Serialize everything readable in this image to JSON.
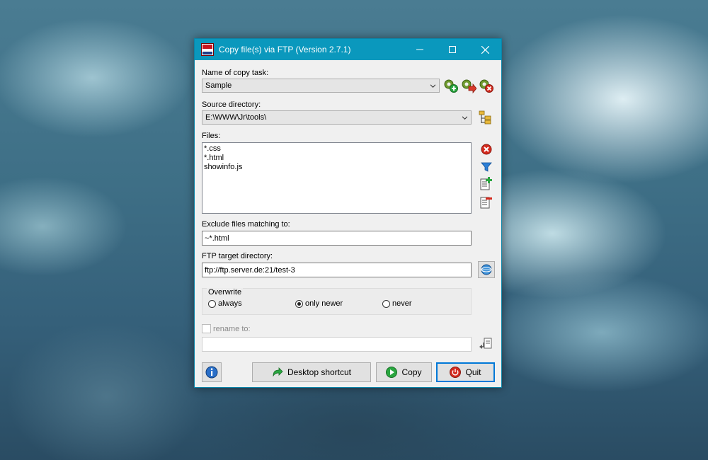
{
  "window": {
    "title": "Copy file(s) via FTP (Version 2.7.1)",
    "controls": [
      "minimize",
      "maximize",
      "close"
    ]
  },
  "task": {
    "label": "Name of copy task:",
    "value": "Sample"
  },
  "source": {
    "label": "Source directory:",
    "value": "E:\\WWW\\Jr\\tools\\"
  },
  "files": {
    "label": "Files:",
    "items": [
      "*.css",
      "*.html",
      "showinfo.js"
    ]
  },
  "exclude": {
    "label": "Exclude files matching to:",
    "value": "~*.html"
  },
  "target": {
    "label": "FTP target directory:",
    "value": "ftp://ftp.server.de:21/test-3"
  },
  "overwrite": {
    "label": "Overwrite",
    "options": [
      "always",
      "only newer",
      "never"
    ],
    "selected": "only newer"
  },
  "rename": {
    "label": "rename to:",
    "checked": false,
    "value": ""
  },
  "buttons": {
    "desktop_shortcut": "Desktop shortcut",
    "copy": "Copy",
    "quit": "Quit"
  },
  "icons": {
    "add_task": "add-task-icon",
    "copy_task": "copy-task-icon",
    "delete_task": "delete-task-icon",
    "browse_folder": "folder-tree-icon",
    "clear_files": "clear-icon",
    "filter": "filter-icon",
    "add_file": "add-file-icon",
    "remove_file": "remove-file-icon",
    "ftp_browse": "ftp-browse-icon",
    "rename_apply": "rename-apply-icon",
    "info": "info-icon"
  },
  "colors": {
    "titlebar": "#0a98bd",
    "accent": "#0078d7",
    "quit_red": "#d42a1e",
    "copy_green": "#2aa640"
  }
}
